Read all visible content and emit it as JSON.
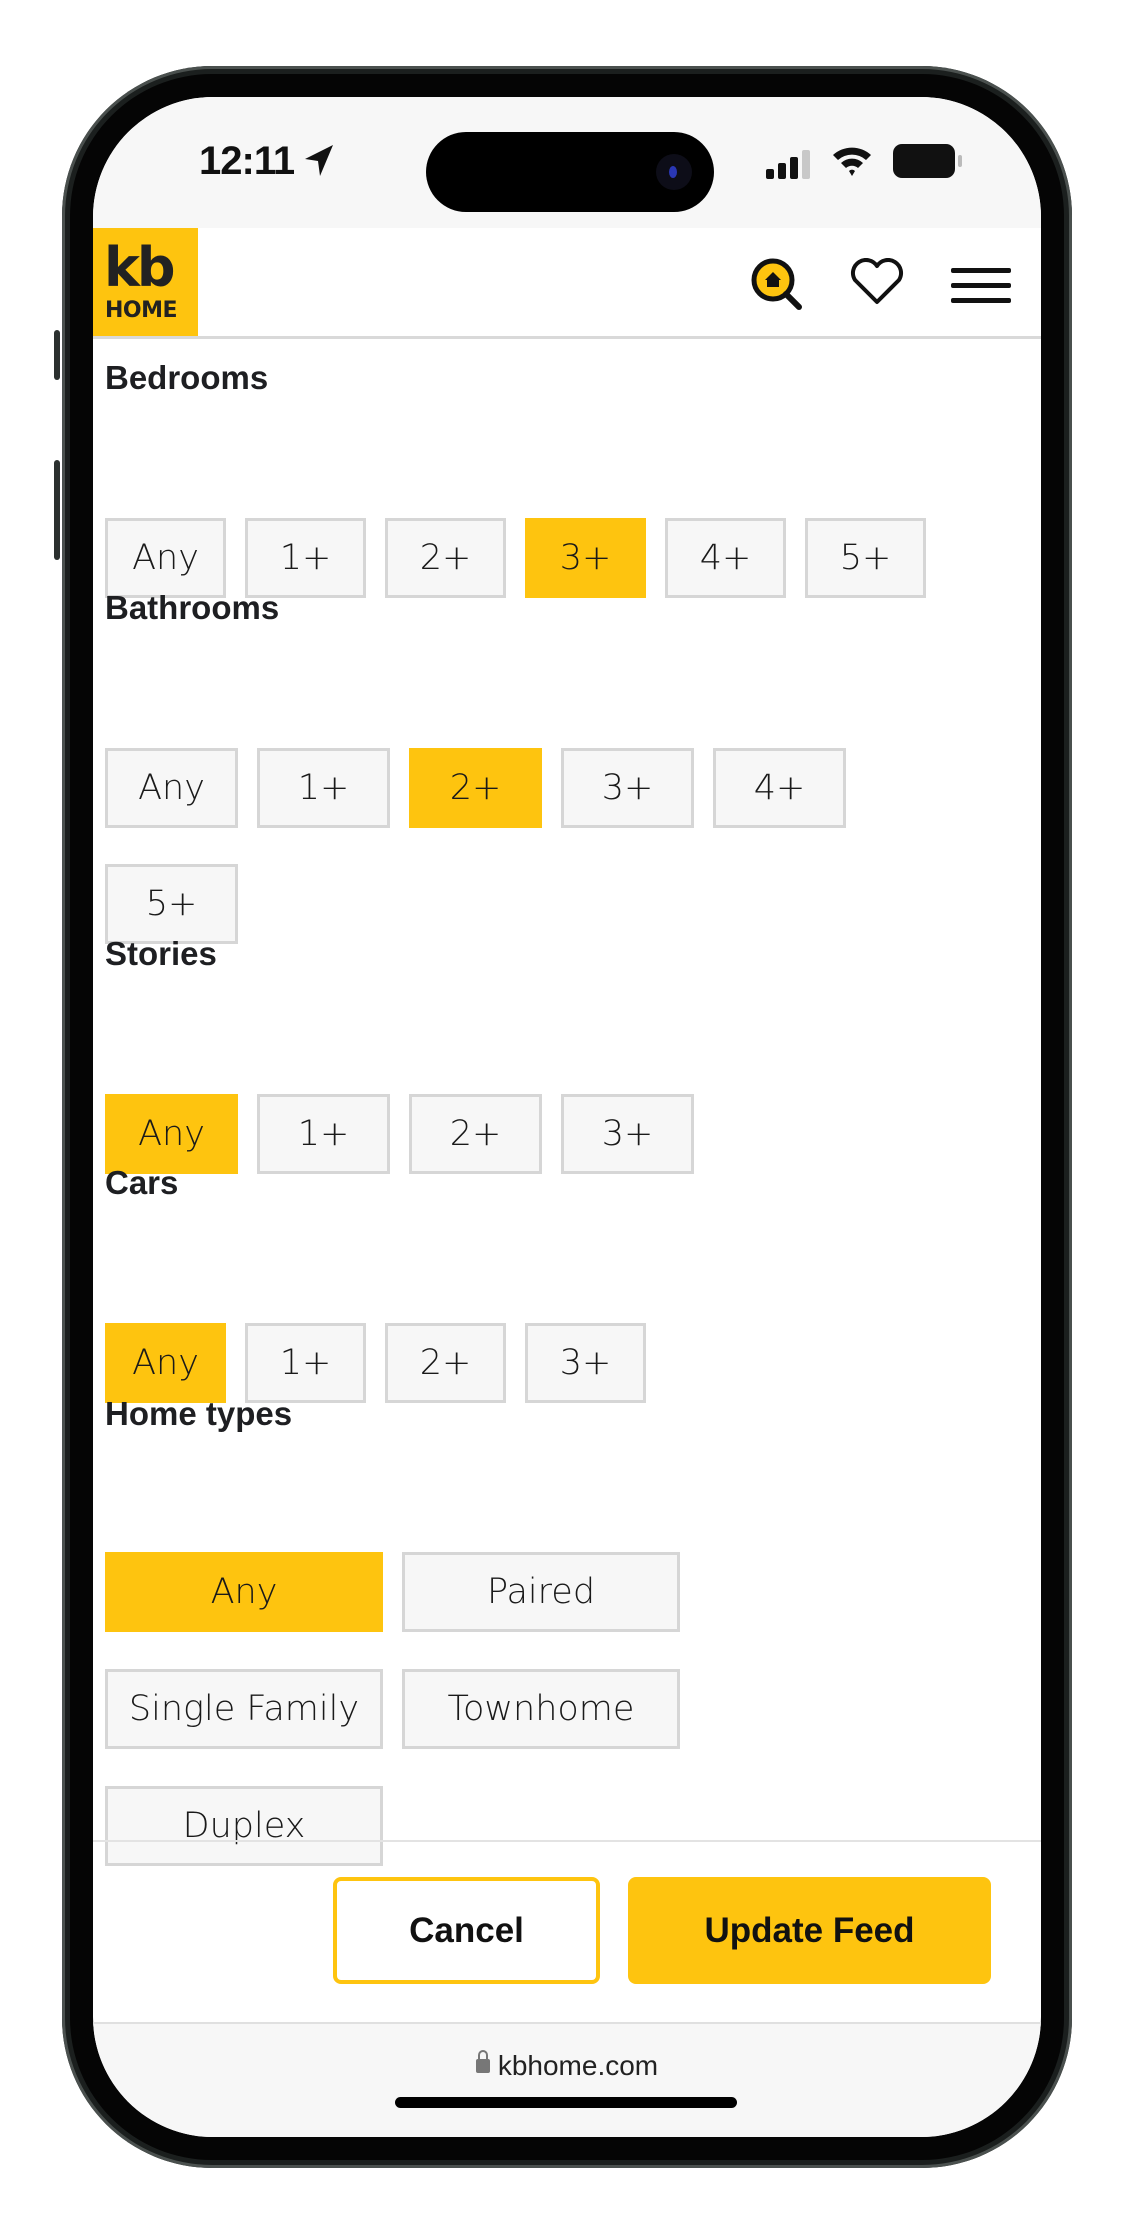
{
  "status_bar": {
    "time": "12:11",
    "icons": [
      "location-arrow-icon",
      "signal-icon",
      "wifi-icon",
      "battery-icon"
    ]
  },
  "header": {
    "logo_line1": "kb",
    "logo_line2": "HOME",
    "icons": [
      "home-search-icon",
      "heart-icon",
      "hamburger-menu-icon"
    ]
  },
  "filters": {
    "bedrooms": {
      "label": "Bedrooms",
      "options": [
        "Any",
        "1+",
        "2+",
        "3+",
        "4+",
        "5+"
      ],
      "selected": "3+"
    },
    "bathrooms": {
      "label": "Bathrooms",
      "options": [
        "Any",
        "1+",
        "2+",
        "3+",
        "4+",
        "5+"
      ],
      "selected": "2+"
    },
    "stories": {
      "label": "Stories",
      "options": [
        "Any",
        "1+",
        "2+",
        "3+"
      ],
      "selected": "Any"
    },
    "cars": {
      "label": "Cars",
      "options": [
        "Any",
        "1+",
        "2+",
        "3+"
      ],
      "selected": "Any"
    },
    "home_types": {
      "label": "Home types",
      "options": [
        "Any",
        "Paired",
        "Single Family",
        "Townhome",
        "Duplex"
      ],
      "selected": "Any"
    }
  },
  "actions": {
    "cancel_label": "Cancel",
    "update_label": "Update Feed"
  },
  "browser": {
    "url": "kbhome.com"
  },
  "colors": {
    "accent": "#fec40f",
    "option_bg": "#f7f7f7",
    "option_border": "#d6d6d6"
  }
}
